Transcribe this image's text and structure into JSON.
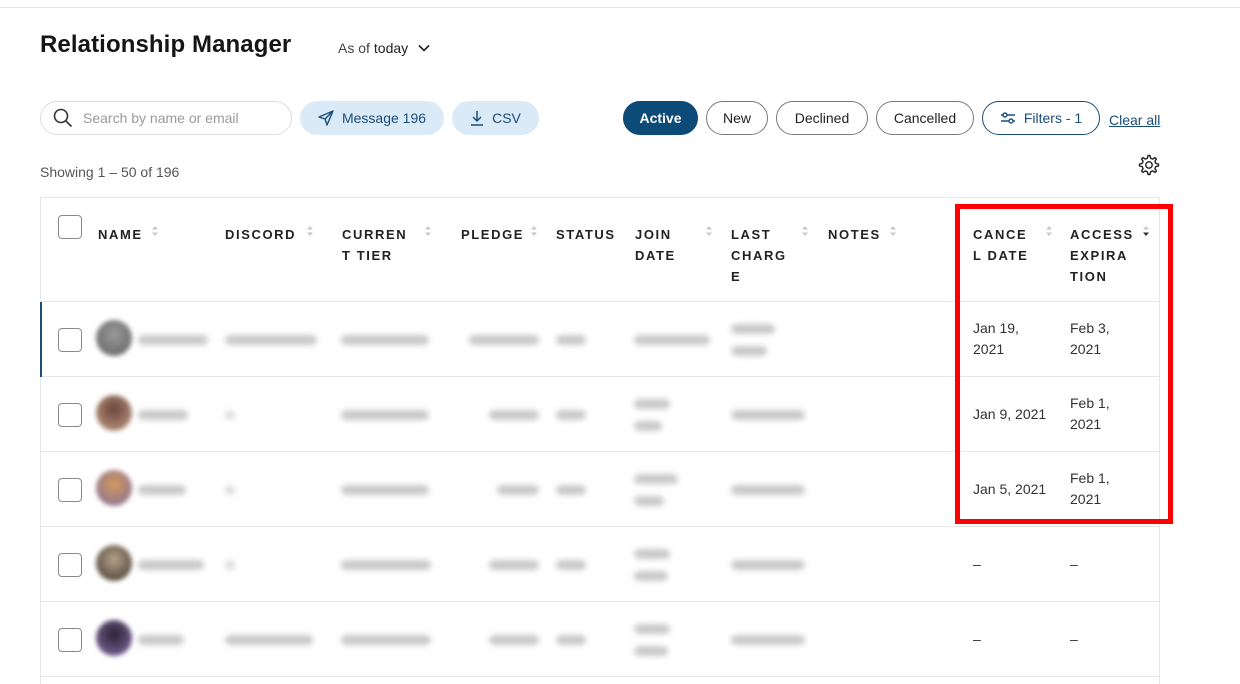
{
  "header": {
    "title": "Relationship Manager",
    "as_of_label": "As of",
    "as_of_value": "today"
  },
  "toolbar": {
    "search_placeholder": "Search by name or email",
    "message_label": "Message 196",
    "csv_label": "CSV",
    "chips": {
      "active": "Active",
      "new": "New",
      "declined": "Declined",
      "cancelled": "Cancelled",
      "filters": "Filters - 1"
    },
    "clear_all": "Clear all"
  },
  "showing": "Showing 1 – 50 of 196",
  "table": {
    "columns": {
      "name": "NAME",
      "discord": "DISCORD",
      "current_tier": [
        "CURREN",
        "T TIER"
      ],
      "pledge": "PLEDGE",
      "status": "STATUS",
      "join_date": [
        "JOIN",
        "DATE"
      ],
      "last_charge": [
        "LAST",
        "CHARG",
        "E"
      ],
      "notes": "NOTES",
      "cancel_date": [
        "CANCE",
        "L DATE"
      ],
      "access_expiration": [
        "ACCESS",
        "EXPIRA",
        "TION"
      ]
    },
    "rows": [
      {
        "cancel_date": [
          "Jan 19,",
          "2021"
        ],
        "access_expiration": [
          "Feb 3,",
          "2021"
        ]
      },
      {
        "cancel_date": [
          "Jan 9, 2021"
        ],
        "access_expiration": [
          "Feb 1,",
          "2021"
        ]
      },
      {
        "cancel_date": [
          "Jan 5, 2021"
        ],
        "access_expiration": [
          "Feb 1,",
          "2021"
        ]
      },
      {
        "cancel_date": [
          "–"
        ],
        "access_expiration": [
          "–"
        ]
      },
      {
        "cancel_date": [
          "–"
        ],
        "access_expiration": [
          "–"
        ]
      }
    ]
  },
  "colors": {
    "accent": "#0c4a78",
    "pill_blue_bg": "#dbeaf7",
    "highlight_box": "#ff0000"
  },
  "icons": {
    "search": "search-icon",
    "message": "send-icon",
    "csv": "download-icon",
    "filters": "sliders-icon",
    "settings": "gear-icon",
    "dropdown": "chevron-down-icon",
    "sort": "sort-icon"
  }
}
